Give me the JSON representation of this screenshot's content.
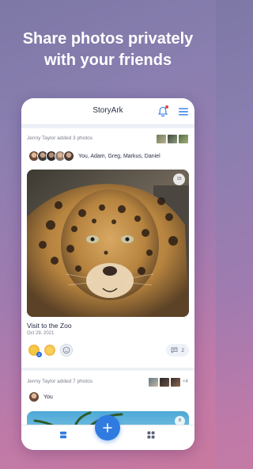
{
  "headline": {
    "line1": "Share photos privately",
    "line2": "with your friends"
  },
  "app": {
    "title": "StoryArk"
  },
  "icons": {
    "bell": "bell-icon",
    "menu": "hamburger-menu-icon",
    "add_reaction": "smiley-add-icon",
    "comment": "comment-icon",
    "nav_stories": "stacked-cards-icon",
    "nav_add": "plus-icon",
    "nav_grid": "grid-icon"
  },
  "colors": {
    "accent": "#2f7be0",
    "notification": "#e04545"
  },
  "stories": [
    {
      "added_by": "Jenny Taylor added 3 photos",
      "shared_with": "You, Adam, Greg, Markus, Daniel",
      "photo_count": "15",
      "title": "Visit to the Zoo",
      "date": "Oct 29, 2021",
      "reaction_count": "2",
      "comment_count": "2"
    },
    {
      "added_by": "Jenny Taylor added 7 photos",
      "more_photos": "+4",
      "shared_with": "You",
      "photo_count": "8"
    }
  ]
}
